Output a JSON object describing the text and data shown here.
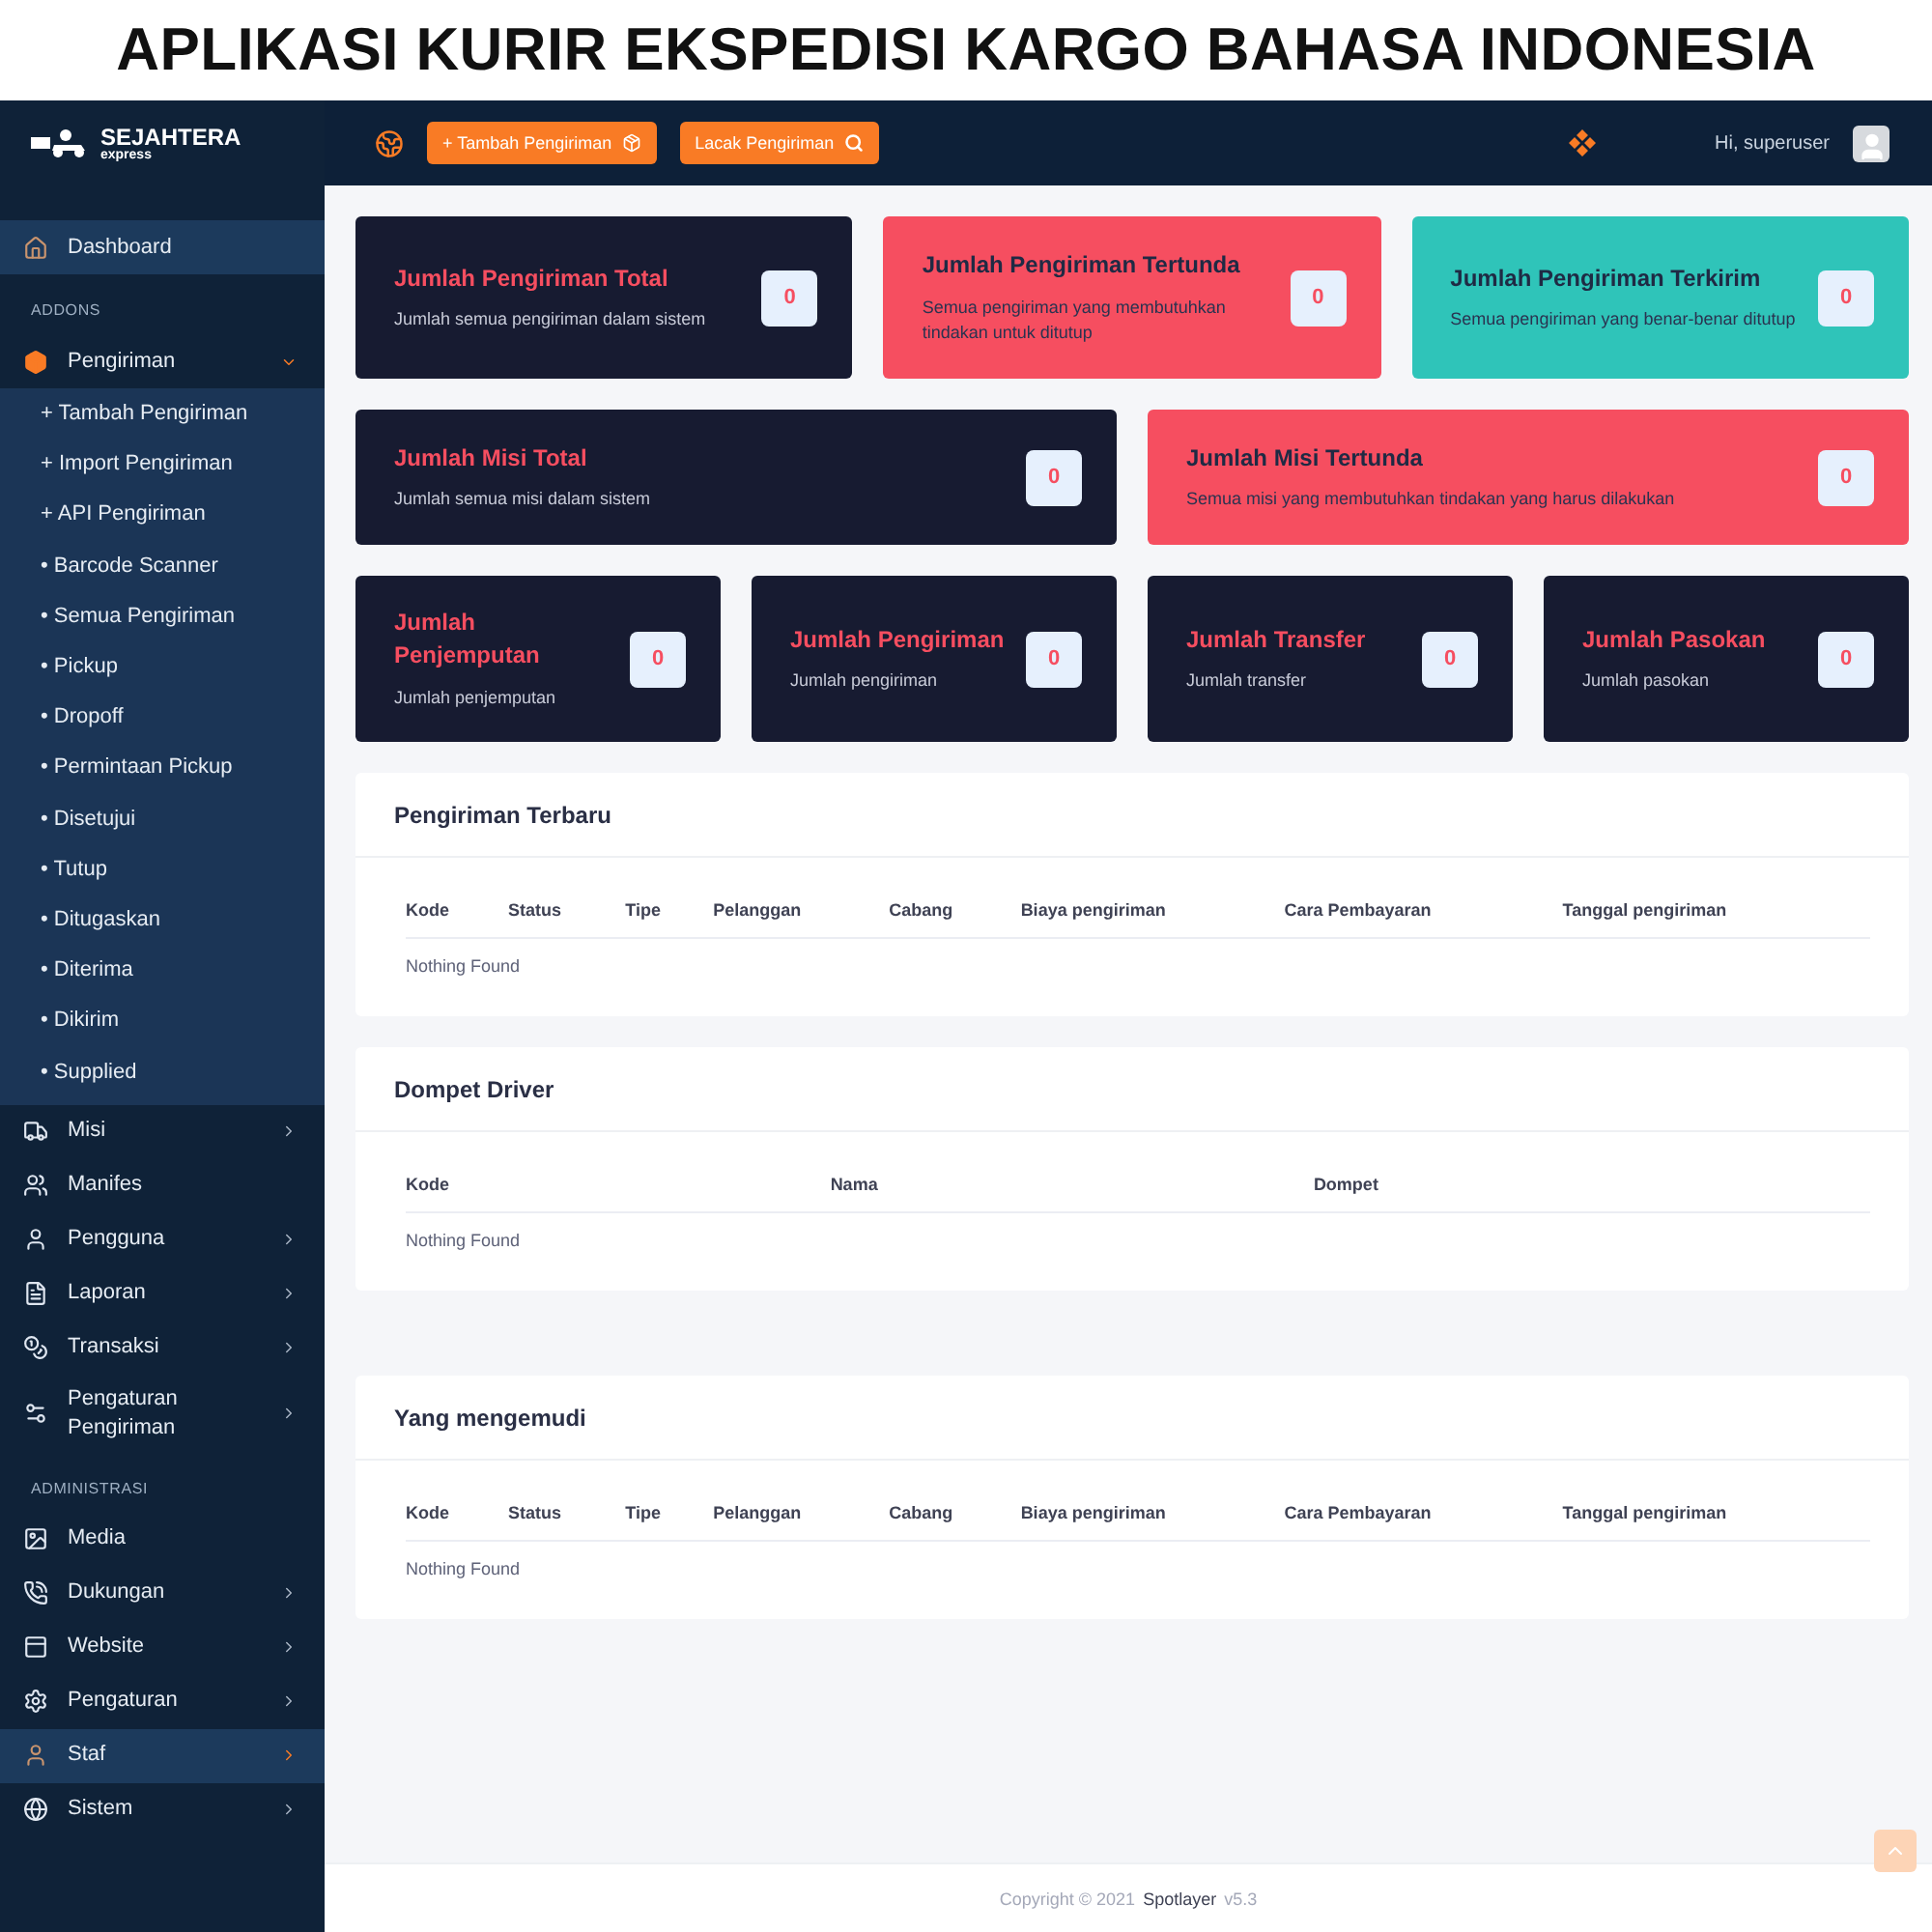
{
  "banner": {
    "title": "APLIKASI KURIR EKSPEDISI KARGO BAHASA INDONESIA"
  },
  "brand": {
    "name": "SEJAHTERA",
    "tagline": "express"
  },
  "topbar": {
    "buttons": [
      {
        "label": "+ Tambah Pengiriman"
      },
      {
        "label": "Lacak Pengiriman"
      }
    ],
    "greeting": "Hi, superuser"
  },
  "sidebar": {
    "items": [
      {
        "kind": "item",
        "label": "Dashboard",
        "selected": true,
        "has_submenu": false
      },
      {
        "kind": "section",
        "label": "ADDONS"
      },
      {
        "kind": "item",
        "label": "Pengiriman",
        "selected": false,
        "has_submenu": true,
        "expanded": true,
        "children": [
          {
            "prefix": "+",
            "label": "Tambah Pengiriman"
          },
          {
            "prefix": "+",
            "label": "Import Pengiriman"
          },
          {
            "prefix": "+",
            "label": "API Pengiriman"
          },
          {
            "prefix": "•",
            "label": "Barcode Scanner"
          },
          {
            "prefix": "•",
            "label": "Semua Pengiriman"
          },
          {
            "prefix": "•",
            "label": "Pickup"
          },
          {
            "prefix": "•",
            "label": "Dropoff"
          },
          {
            "prefix": "•",
            "label": "Permintaan Pickup"
          },
          {
            "prefix": "•",
            "label": "Disetujui"
          },
          {
            "prefix": "•",
            "label": "Tutup"
          },
          {
            "prefix": "•",
            "label": "Ditugaskan"
          },
          {
            "prefix": "•",
            "label": "Diterima"
          },
          {
            "prefix": "•",
            "label": "Dikirim"
          },
          {
            "prefix": "•",
            "label": "Supplied"
          }
        ]
      },
      {
        "kind": "item",
        "label": "Misi",
        "selected": false,
        "has_submenu": true,
        "expanded": false
      },
      {
        "kind": "item",
        "label": "Manifes",
        "selected": false,
        "has_submenu": false
      },
      {
        "kind": "item",
        "label": "Pengguna",
        "selected": false,
        "has_submenu": true,
        "expanded": false
      },
      {
        "kind": "item",
        "label": "Laporan",
        "selected": false,
        "has_submenu": true,
        "expanded": false
      },
      {
        "kind": "item",
        "label": "Transaksi",
        "selected": false,
        "has_submenu": true,
        "expanded": false
      },
      {
        "kind": "item",
        "label": "Pengaturan Pengiriman",
        "selected": false,
        "has_submenu": true,
        "expanded": false
      },
      {
        "kind": "section",
        "label": "ADMINISTRASI"
      },
      {
        "kind": "item",
        "label": "Media",
        "selected": false,
        "has_submenu": false
      },
      {
        "kind": "item",
        "label": "Dukungan",
        "selected": false,
        "has_submenu": true,
        "expanded": false
      },
      {
        "kind": "item",
        "label": "Website",
        "selected": false,
        "has_submenu": true,
        "expanded": false
      },
      {
        "kind": "item",
        "label": "Pengaturan",
        "selected": false,
        "has_submenu": true,
        "expanded": false
      },
      {
        "kind": "item",
        "label": "Staf",
        "selected": true,
        "has_submenu": true,
        "expanded": false
      },
      {
        "kind": "item",
        "label": "Sistem",
        "selected": false,
        "has_submenu": true,
        "expanded": false
      }
    ]
  },
  "stat_rows": [
    [
      {
        "title": "Jumlah Pengiriman Total",
        "description": "Jumlah semua pengiriman dalam sistem",
        "value": "0",
        "color": "#171b31"
      },
      {
        "title": "Jumlah Pengiriman Tertunda",
        "description": "Semua pengiriman yang membutuhkan tindakan untuk ditutup",
        "value": "0",
        "color": "#f64e60"
      },
      {
        "title": "Jumlah Pengiriman Terkirim",
        "description": "Semua pengiriman yang benar-benar ditutup",
        "value": "0",
        "color": "#2fc4b9"
      }
    ],
    [
      {
        "title": "Jumlah Misi Total",
        "description": "Jumlah semua misi dalam sistem",
        "value": "0",
        "color": "#171b31"
      },
      {
        "title": "Jumlah Misi Tertunda",
        "description": "Semua misi yang membutuhkan tindakan yang harus dilakukan",
        "value": "0",
        "color": "#f64e60"
      }
    ],
    [
      {
        "title": "Jumlah Penjemputan",
        "description": "Jumlah penjemputan",
        "value": "0",
        "color": "#171b31"
      },
      {
        "title": "Jumlah Pengiriman",
        "description": "Jumlah pengiriman",
        "value": "0",
        "color": "#171b31"
      },
      {
        "title": "Jumlah Transfer",
        "description": "Jumlah transfer",
        "value": "0",
        "color": "#171b31"
      },
      {
        "title": "Jumlah Pasokan",
        "description": "Jumlah pasokan",
        "value": "0",
        "color": "#171b31"
      }
    ]
  ],
  "panels": [
    {
      "title": "Pengiriman Terbaru",
      "columns": [
        "Kode",
        "Status",
        "Tipe",
        "Pelanggan",
        "Cabang",
        "Biaya pengiriman",
        "Cara Pembayaran",
        "Tanggal pengiriman"
      ],
      "empty": "Nothing Found"
    },
    {
      "title": "Dompet Driver",
      "columns": [
        "Kode",
        "Nama",
        "Dompet"
      ],
      "empty": "Nothing Found"
    },
    {
      "title": "Yang mengemudi",
      "columns": [
        "Kode",
        "Status",
        "Tipe",
        "Pelanggan",
        "Cabang",
        "Biaya pengiriman",
        "Cara Pembayaran",
        "Tanggal pengiriman"
      ],
      "empty": "Nothing Found"
    }
  ],
  "footer": {
    "copyright": "Copyright © 2021",
    "brand": "Spotlayer",
    "version": "v5.3"
  }
}
